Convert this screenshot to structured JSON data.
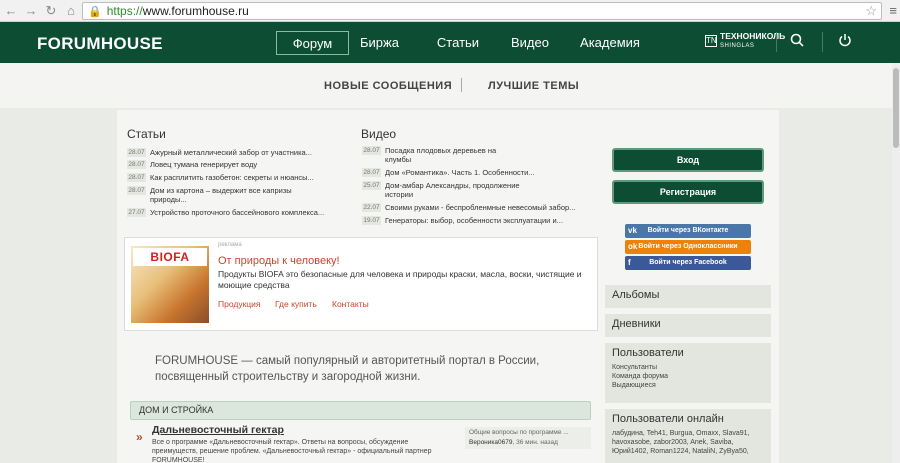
{
  "browser": {
    "url_scheme": "https://",
    "url_host": "www.forumhouse.ru"
  },
  "header": {
    "logo": "FORUMHOUSE",
    "nav": [
      "Форум",
      "Биржа",
      "Статьи",
      "Видео",
      "Академия"
    ],
    "partner_name": "ТЕХНОНИКОЛЬ",
    "partner_sub": "SHINGLAS",
    "partner_mark": "TN"
  },
  "subnav": {
    "new_messages": "НОВЫЕ СООБЩЕНИЯ",
    "best_topics": "ЛУЧШИЕ ТЕМЫ"
  },
  "articles": {
    "title": "Статьи",
    "items": [
      {
        "date": "28.07",
        "text": "Ажурный металлический забор от участника..."
      },
      {
        "date": "28.07",
        "text": "Ловец тумана генерирует воду"
      },
      {
        "date": "28.07",
        "text": "Как расплитить газобетон: секреты и нюансы..."
      },
      {
        "date": "28.07",
        "text": "Дом из картона – выдержит все капризы природы..."
      },
      {
        "date": "27.07",
        "text": "Устройство проточного бассейнового комплекса..."
      }
    ]
  },
  "videos": {
    "title": "Видео",
    "items": [
      {
        "date": "28.07",
        "text": "Посадка плодовых деревьев на клумбы"
      },
      {
        "date": "28.07",
        "text": "Дом «Романтика». Часть 1. Особенности..."
      },
      {
        "date": "25.07",
        "text": "Дом-амбар Александры, продолжение истории"
      },
      {
        "date": "22.07",
        "text": "Своими руками - беспробленмные невесомый забор..."
      },
      {
        "date": "19.07",
        "text": "Генераторы: выбор, особенности эксплуатации и..."
      }
    ]
  },
  "ad": {
    "logo": "BIOFA",
    "tag": "реклама",
    "title": "От природы к человеку!",
    "text": "Продукты BIOFA это безопасные для человека и природы краски, масла, воски, чистящие и моющие средства",
    "links": [
      "Продукция",
      "Где купить",
      "Контакты"
    ]
  },
  "intro": "FORUMHOUSE — самый популярный и авторитетный портал в России, посвященный строительству и загородной жизни.",
  "category": {
    "title": "ДОМ И СТРОЙКА"
  },
  "forum": {
    "title": "Дальневосточный гектар",
    "desc": "Все о программе «Дальневосточный гектар». Ответы на вопросы, обсуждение преимуществ, решение проблем. «Дальневосточный гектар» - официальный партнер FORUMHOUSE!",
    "last_topic": "Общие вопросы по программе ...",
    "last_user": "Вероника0679",
    "last_time": ", 36 мин. назад"
  },
  "auth": {
    "login": "Вход",
    "register": "Регистрация"
  },
  "social": [
    {
      "label": "Войти через ВКонтакте",
      "icon": "vk",
      "color": "#4a76a8"
    },
    {
      "label": "Войти через Одноклассники",
      "icon": "ok",
      "color": "#ee8208"
    },
    {
      "label": "Войти через Facebook",
      "icon": "f",
      "color": "#3b5998"
    }
  ],
  "sidebar": {
    "albums": "Альбомы",
    "diaries": "Дневники",
    "users": "Пользователи",
    "users_links": [
      "Консультанты",
      "Команда форума",
      "Выдающиеся"
    ],
    "online_title": "Пользователи онлайн",
    "online_list": "лабудина, Teh41, Burgua, Omaxx, Slava91, havoxasobe, zabor2003, Anek, Saviba, Юрий1402, Roman1224, NataliN, ZyBya50,"
  }
}
